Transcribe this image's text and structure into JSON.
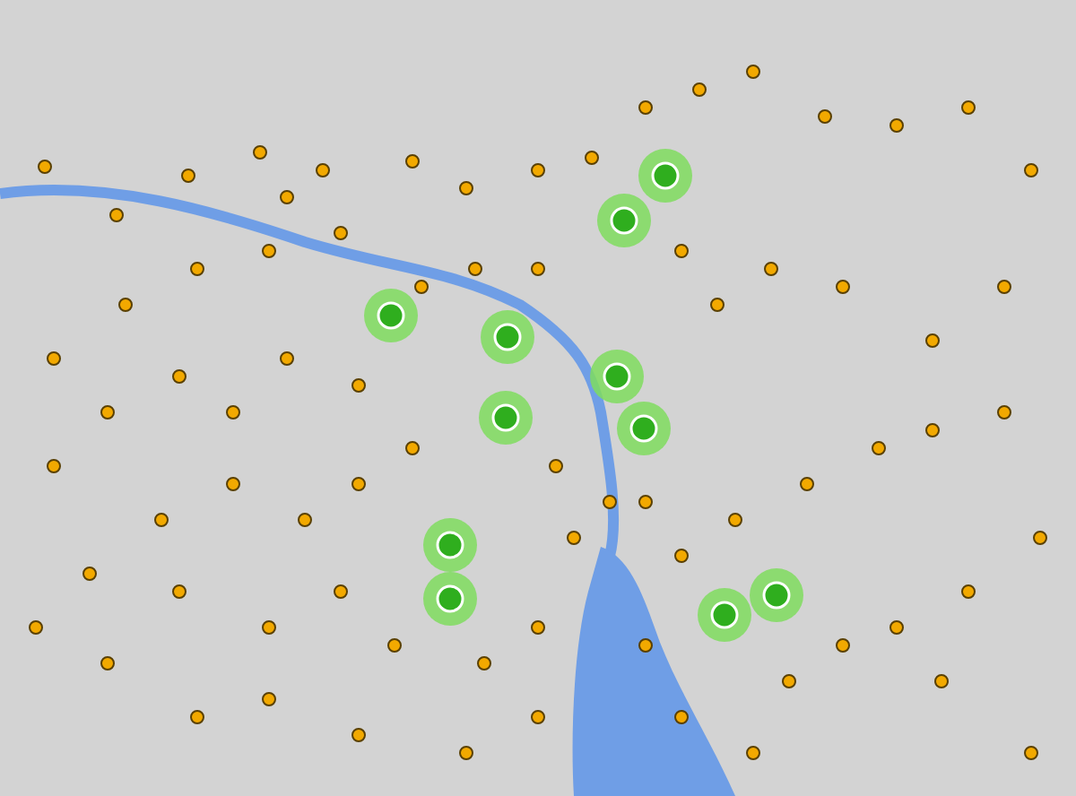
{
  "map": {
    "markers": [
      {
        "kind": "cluster"
      },
      {
        "kind": "cluster"
      },
      {
        "kind": "cluster"
      },
      {
        "kind": "cluster"
      },
      {
        "kind": "cluster"
      },
      {
        "kind": "cluster"
      },
      {
        "kind": "cluster"
      },
      {
        "kind": "cluster"
      },
      {
        "kind": "cluster"
      },
      {
        "kind": "cluster"
      },
      {
        "kind": "cluster"
      },
      {
        "kind": "point"
      },
      {
        "kind": "point"
      },
      {
        "kind": "point"
      },
      {
        "kind": "point"
      },
      {
        "kind": "point"
      },
      {
        "kind": "point"
      },
      {
        "kind": "point"
      },
      {
        "kind": "point"
      },
      {
        "kind": "point"
      },
      {
        "kind": "point"
      },
      {
        "kind": "point"
      },
      {
        "kind": "point"
      },
      {
        "kind": "point"
      },
      {
        "kind": "point"
      },
      {
        "kind": "point"
      },
      {
        "kind": "point"
      },
      {
        "kind": "point"
      },
      {
        "kind": "point"
      },
      {
        "kind": "point"
      },
      {
        "kind": "point"
      },
      {
        "kind": "point"
      },
      {
        "kind": "point"
      },
      {
        "kind": "point"
      },
      {
        "kind": "point"
      },
      {
        "kind": "point"
      },
      {
        "kind": "point"
      },
      {
        "kind": "point"
      },
      {
        "kind": "point"
      },
      {
        "kind": "point"
      },
      {
        "kind": "point"
      },
      {
        "kind": "point"
      },
      {
        "kind": "point"
      },
      {
        "kind": "point"
      },
      {
        "kind": "point"
      },
      {
        "kind": "point"
      },
      {
        "kind": "point"
      },
      {
        "kind": "point"
      },
      {
        "kind": "point"
      },
      {
        "kind": "point"
      },
      {
        "kind": "point"
      },
      {
        "kind": "point"
      },
      {
        "kind": "point"
      },
      {
        "kind": "point"
      },
      {
        "kind": "point"
      },
      {
        "kind": "point"
      },
      {
        "kind": "point"
      },
      {
        "kind": "point"
      },
      {
        "kind": "point"
      },
      {
        "kind": "point"
      },
      {
        "kind": "point"
      },
      {
        "kind": "point"
      },
      {
        "kind": "point"
      },
      {
        "kind": "point"
      },
      {
        "kind": "point"
      },
      {
        "kind": "point"
      },
      {
        "kind": "point"
      },
      {
        "kind": "point"
      },
      {
        "kind": "point"
      },
      {
        "kind": "point"
      },
      {
        "kind": "point"
      },
      {
        "kind": "point"
      },
      {
        "kind": "point"
      },
      {
        "kind": "point"
      },
      {
        "kind": "point"
      },
      {
        "kind": "point"
      },
      {
        "kind": "point"
      },
      {
        "kind": "point"
      },
      {
        "kind": "point"
      },
      {
        "kind": "point"
      },
      {
        "kind": "point"
      },
      {
        "kind": "point"
      },
      {
        "kind": "point"
      },
      {
        "kind": "point"
      },
      {
        "kind": "point"
      },
      {
        "kind": "point"
      },
      {
        "kind": "point"
      }
    ]
  }
}
